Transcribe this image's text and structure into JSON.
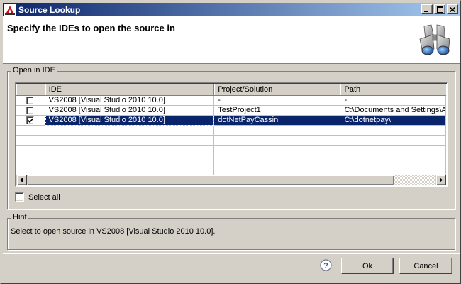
{
  "window": {
    "title": "Source Lookup",
    "minimize_icon": "minimize-icon",
    "maximize_icon": "maximize-icon",
    "close_icon": "close-icon"
  },
  "header": {
    "title": "Specify the IDEs to open the source in",
    "icon": "binoculars-icon"
  },
  "open_in_ide": {
    "group_label": "Open in IDE",
    "columns": [
      "",
      "IDE",
      "Project/Solution",
      "Path"
    ],
    "rows": [
      {
        "checked": false,
        "ide": "VS2008 [Visual Studio 2010 10.0]",
        "project": "-",
        "path": "-",
        "selected": false
      },
      {
        "checked": false,
        "ide": "VS2008 [Visual Studio 2010 10.0]",
        "project": "TestProject1",
        "path": "C:\\Documents and Settings\\A",
        "selected": false
      },
      {
        "checked": true,
        "ide": "VS2008 [Visual Studio 2010 10.0]",
        "project": "dotNetPayCassini",
        "path": "C:\\dotnetpay\\",
        "selected": true
      }
    ],
    "select_all_label": "Select all",
    "select_all_checked": false
  },
  "hint": {
    "group_label": "Hint",
    "text": "Select to open source in VS2008 [Visual Studio 2010 10.0]."
  },
  "buttons": {
    "ok": "Ok",
    "cancel": "Cancel",
    "help_icon": "help-icon"
  },
  "colors": {
    "selection": "#0a246a",
    "titlebar_start": "#0a246a",
    "titlebar_end": "#a6caf0",
    "face": "#d4d0c8"
  }
}
